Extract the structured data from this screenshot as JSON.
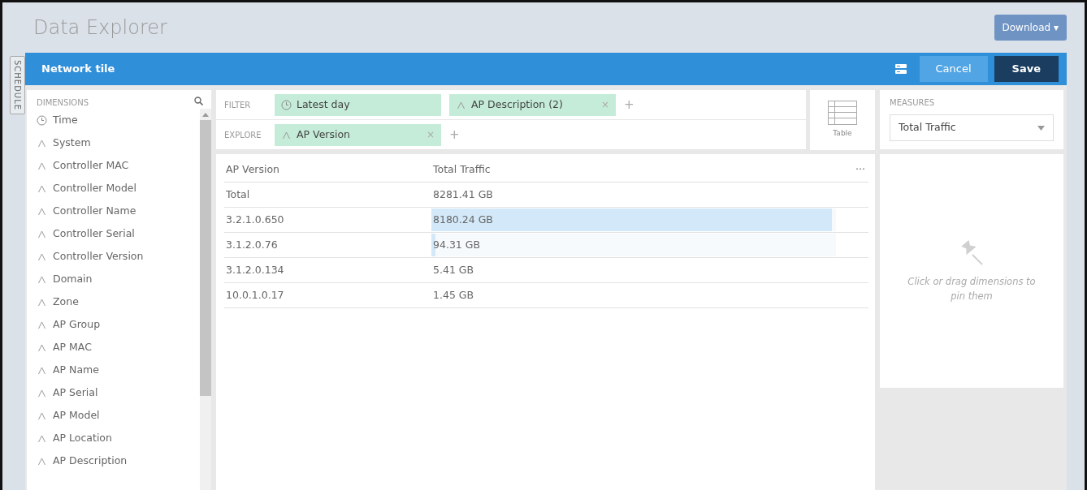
{
  "page": {
    "title": "Data Explorer",
    "download_button": "Download ▾"
  },
  "side_tab": {
    "label": "SCHEDULE"
  },
  "tile_bar": {
    "title": "Network tile",
    "cancel": "Cancel",
    "save": "Save"
  },
  "dimensions": {
    "heading": "DIMENSIONS",
    "items": [
      {
        "label": "Time",
        "kind": "time"
      },
      {
        "label": "System",
        "kind": "string"
      },
      {
        "label": "Controller MAC",
        "kind": "string"
      },
      {
        "label": "Controller Model",
        "kind": "string"
      },
      {
        "label": "Controller Name",
        "kind": "string"
      },
      {
        "label": "Controller Serial",
        "kind": "string"
      },
      {
        "label": "Controller Version",
        "kind": "string"
      },
      {
        "label": "Domain",
        "kind": "string"
      },
      {
        "label": "Zone",
        "kind": "string"
      },
      {
        "label": "AP Group",
        "kind": "string"
      },
      {
        "label": "AP MAC",
        "kind": "string"
      },
      {
        "label": "AP Name",
        "kind": "string"
      },
      {
        "label": "AP Serial",
        "kind": "string"
      },
      {
        "label": "AP Model",
        "kind": "string"
      },
      {
        "label": "AP Location",
        "kind": "string"
      },
      {
        "label": "AP Description",
        "kind": "string"
      }
    ]
  },
  "filter": {
    "label": "FILTER",
    "pills": [
      {
        "label": "Latest day",
        "kind": "time"
      },
      {
        "label": "AP Description (2)",
        "kind": "string",
        "remove": "×"
      }
    ],
    "add": "+"
  },
  "explore": {
    "label": "EXPLORE",
    "pills": [
      {
        "label": "AP Version",
        "kind": "string",
        "remove": "×"
      }
    ],
    "add": "+"
  },
  "view": {
    "label": "Table"
  },
  "table": {
    "columns": [
      "AP Version",
      "Total Traffic"
    ],
    "menu": "···",
    "rows": [
      {
        "cells": [
          "Total",
          "8281.41 GB"
        ]
      },
      {
        "cells": [
          "3.2.1.0.650",
          "8180.24 GB"
        ],
        "level": 0.99
      },
      {
        "cells": [
          "3.1.2.0.76",
          "94.31 GB"
        ],
        "level": 0.01
      },
      {
        "cells": [
          "3.1.2.0.134",
          "5.41 GB"
        ]
      },
      {
        "cells": [
          "10.0.1.0.17",
          "1.45 GB"
        ]
      }
    ]
  },
  "measures": {
    "heading": "MEASURES",
    "selected": "Total Traffic"
  },
  "pin_panel": {
    "hint": "Click or drag dimensions to pin them"
  }
}
